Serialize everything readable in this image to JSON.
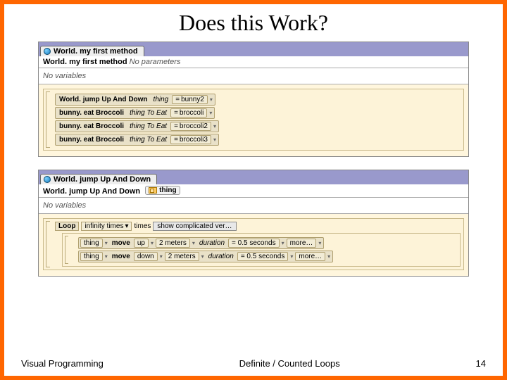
{
  "slide": {
    "title": "Does this Work?"
  },
  "panel1": {
    "tab": "World. my first method",
    "signature_name": "World. my first method",
    "signature_params": "No parameters",
    "no_vars": "No variables",
    "calls": [
      {
        "method": "World. jump Up And Down",
        "param": "thing",
        "value": "bunny2"
      },
      {
        "method": "bunny. eat Broccoli",
        "param": "thing To Eat",
        "value": "broccoli"
      },
      {
        "method": "bunny. eat Broccoli",
        "param": "thing To Eat",
        "value": "broccoli2"
      },
      {
        "method": "bunny. eat Broccoli",
        "param": "thing To Eat",
        "value": "broccoli3"
      }
    ]
  },
  "panel2": {
    "tab": "World. jump Up And Down",
    "signature_name": "World. jump Up And Down",
    "param_name": "thing",
    "no_vars": "No variables",
    "loop": {
      "kw": "Loop",
      "count": "infinity times",
      "word": "times",
      "button": "show complicated ver…",
      "lines": [
        {
          "target": "thing",
          "verb": "move",
          "arg": "up",
          "amount": "2 meters",
          "durlabel": "duration",
          "durval": "= 0.5 seconds",
          "more": "more…"
        },
        {
          "target": "thing",
          "verb": "move",
          "arg": "down",
          "amount": "2 meters",
          "durlabel": "duration",
          "durval": "= 0.5 seconds",
          "more": "more…"
        }
      ]
    }
  },
  "footer": {
    "left": "Visual Programming",
    "center": "Definite / Counted Loops",
    "right": "14"
  }
}
